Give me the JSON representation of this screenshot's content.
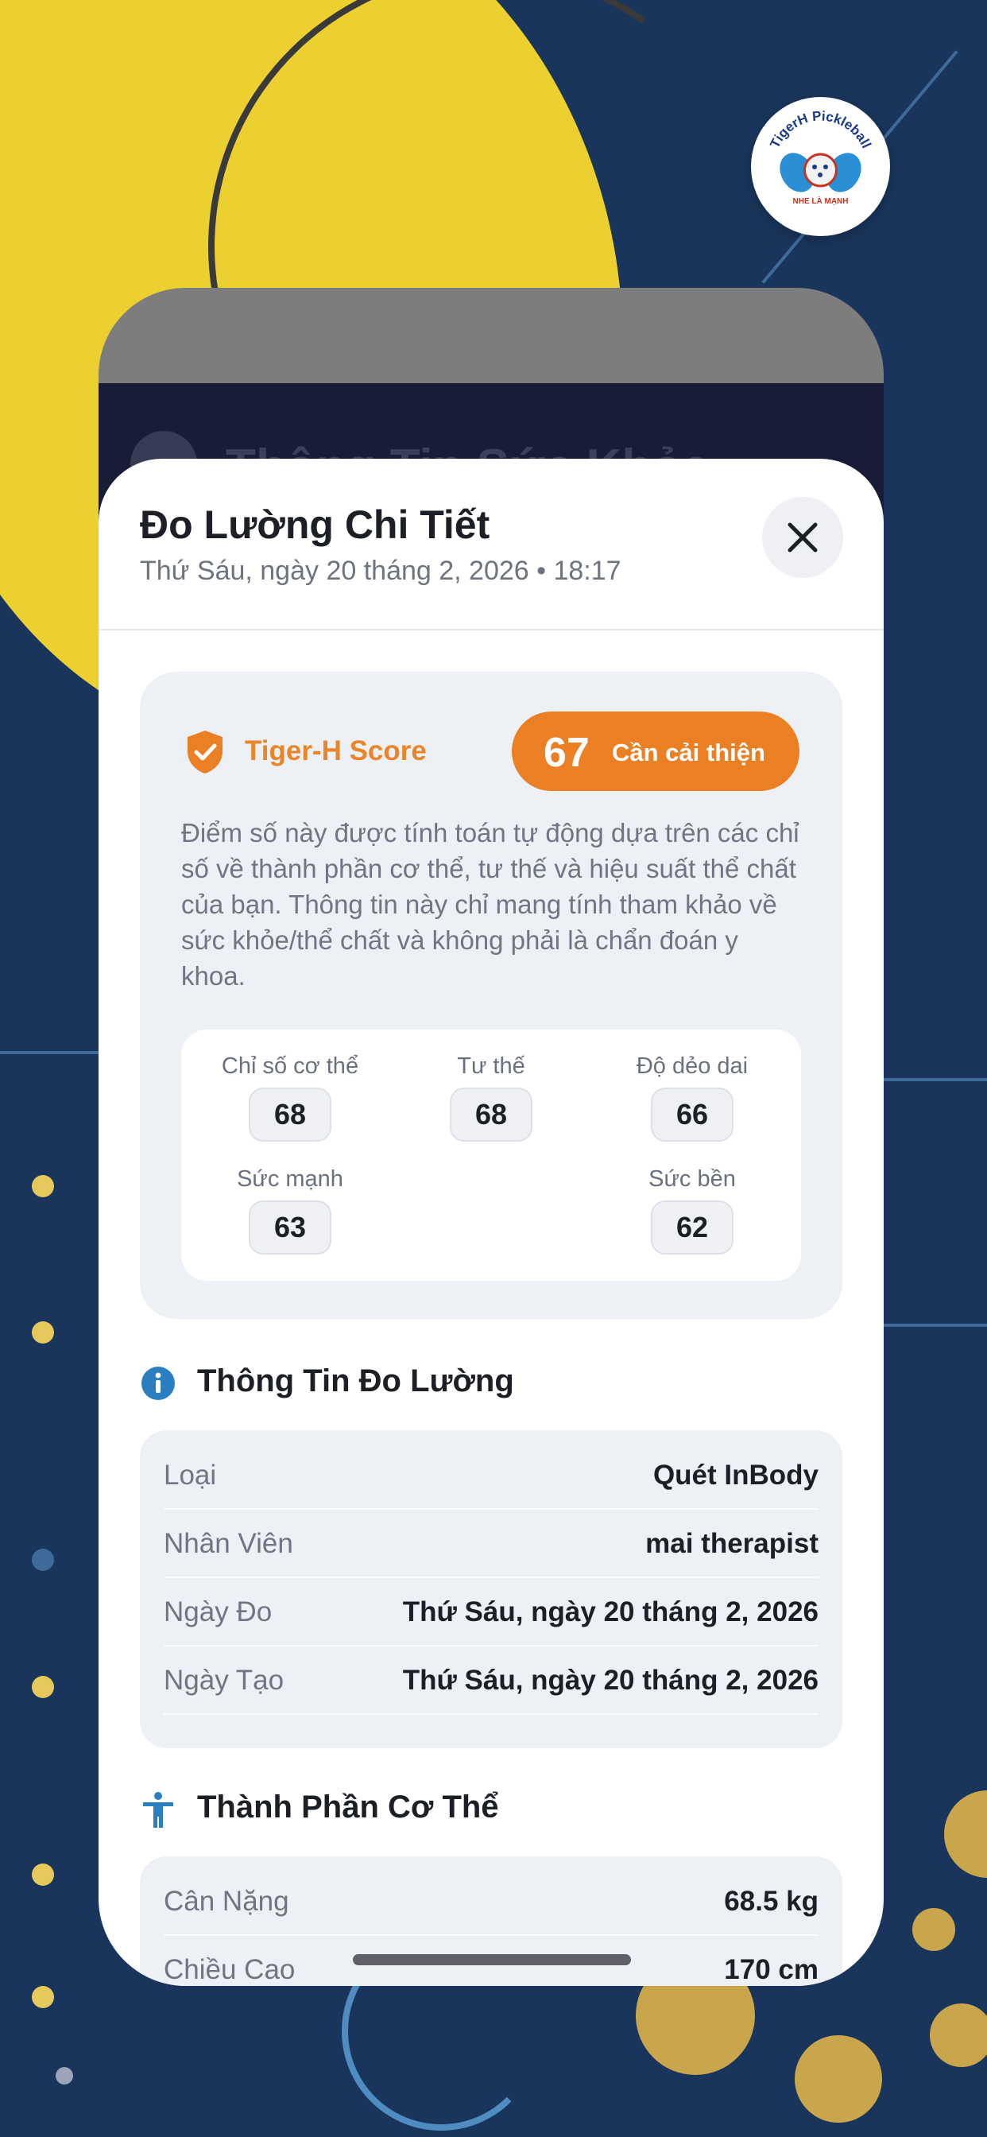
{
  "sheet": {
    "title": "Đo Lường Chi Tiết",
    "subtitle": "Thứ Sáu, ngày 20 tháng 2, 2026 • 18:17",
    "underlying_title": "Thông Tin Sức Khỏe"
  },
  "score": {
    "label": "Tiger-H Score",
    "value": "67",
    "status": "Cần cải thiện",
    "description": "Điểm số này được tính toán tự động dựa trên các chỉ số về thành phần cơ thể, tư thế và hiệu suất thể chất của bạn. Thông tin này chỉ mang tính tham khảo về sức khỏe/thể chất và không phải là chẩn đoán y khoa.",
    "accent_color": "#ea7f23",
    "metrics": [
      {
        "label": "Chỉ số cơ thể",
        "value": "68"
      },
      {
        "label": "Tư thế",
        "value": "68"
      },
      {
        "label": "Độ dẻo dai",
        "value": "66"
      },
      {
        "label": "Sức mạnh",
        "value": "63"
      },
      {
        "label": "Sức bền",
        "value": "62"
      }
    ]
  },
  "measurement_info": {
    "title": "Thông Tin Đo Lường",
    "icon": "info-icon",
    "rows": [
      {
        "key": "Loại",
        "value": "Quét InBody"
      },
      {
        "key": "Nhân Viên",
        "value": "mai therapist"
      },
      {
        "key": "Ngày Đo",
        "value": "Thứ Sáu, ngày 20 tháng 2, 2026"
      },
      {
        "key": "Ngày Tạo",
        "value": "Thứ Sáu, ngày 20 tháng 2, 2026"
      }
    ]
  },
  "body_composition": {
    "title": "Thành Phần Cơ Thể",
    "icon": "person-icon",
    "rows": [
      {
        "key": "Cân Nặng",
        "value": "68.5 kg"
      },
      {
        "key": "Chiều Cao",
        "value": "170 cm"
      }
    ]
  },
  "logo": {
    "name": "TigerH Pickleball",
    "tagline": "NHE LÀ MẠNH"
  }
}
